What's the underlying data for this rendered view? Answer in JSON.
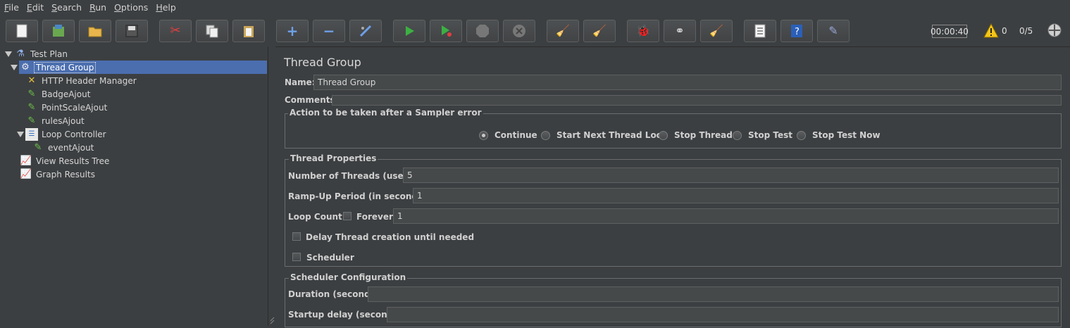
{
  "menu": [
    {
      "pre": "",
      "mn": "F",
      "post": "ile"
    },
    {
      "pre": "",
      "mn": "E",
      "post": "dit"
    },
    {
      "pre": "",
      "mn": "S",
      "post": "earch"
    },
    {
      "pre": "",
      "mn": "R",
      "post": "un"
    },
    {
      "pre": "",
      "mn": "O",
      "post": "ptions"
    },
    {
      "pre": "",
      "mn": "H",
      "post": "elp"
    }
  ],
  "toolbar": {
    "buttons": [
      "new-icon",
      "templates-icon",
      "open-icon",
      "save-icon",
      "cut-icon",
      "copy-icon",
      "paste-icon",
      "expand-icon",
      "collapse-icon",
      "toggle-icon",
      "start-icon",
      "start-no-pause-icon",
      "stop-icon",
      "shutdown-icon",
      "clear-icon",
      "clear-all-icon",
      "search-icon",
      "reset-search-icon",
      "function-helper-icon",
      "help-icon",
      "log-viewer-icon",
      "remote-start-icon",
      "remote-stop-icon"
    ],
    "timer": "00:00:40",
    "warning_count": "0",
    "threads": "0/5"
  },
  "tree": {
    "nodes": [
      {
        "label": "Test Plan",
        "icon": "test-plan-icon"
      },
      {
        "label": "Thread Group",
        "icon": "thread-group-icon"
      },
      {
        "label": "HTTP Header Manager",
        "icon": "header-manager-icon"
      },
      {
        "label": "BadgeAjout",
        "icon": "sampler-icon"
      },
      {
        "label": "PointScaleAjout",
        "icon": "sampler-icon"
      },
      {
        "label": "rulesAjout",
        "icon": "sampler-icon"
      },
      {
        "label": "Loop Controller",
        "icon": "loop-controller-icon"
      },
      {
        "label": "eventAjout",
        "icon": "sampler-icon"
      },
      {
        "label": "View Results Tree",
        "icon": "listener-icon"
      },
      {
        "label": "Graph Results",
        "icon": "listener-icon"
      }
    ]
  },
  "panel": {
    "title": "Thread Group",
    "name_label": "Name:",
    "name_value": "Thread Group",
    "comments_label": "Comments:",
    "comments_value": "",
    "error_action": {
      "title": "Action to be taken after a Sampler error",
      "options": [
        "Continue",
        "Start Next Thread Loop",
        "Stop Thread",
        "Stop Test",
        "Stop Test Now"
      ],
      "selected": "Continue"
    },
    "thread_props": {
      "title": "Thread Properties",
      "threads_label": "Number of Threads (users):",
      "threads_value": "5",
      "rampup_label": "Ramp-Up Period (in seconds):",
      "rampup_value": "1",
      "loop_label": "Loop Count:",
      "forever_label": "Forever",
      "loop_value": "1",
      "delay_label": "Delay Thread creation until needed",
      "scheduler_label": "Scheduler"
    },
    "scheduler_config": {
      "title": "Scheduler Configuration",
      "duration_label": "Duration (seconds)",
      "duration_value": "",
      "startup_label": "Startup delay (seconds)",
      "startup_value": ""
    }
  }
}
